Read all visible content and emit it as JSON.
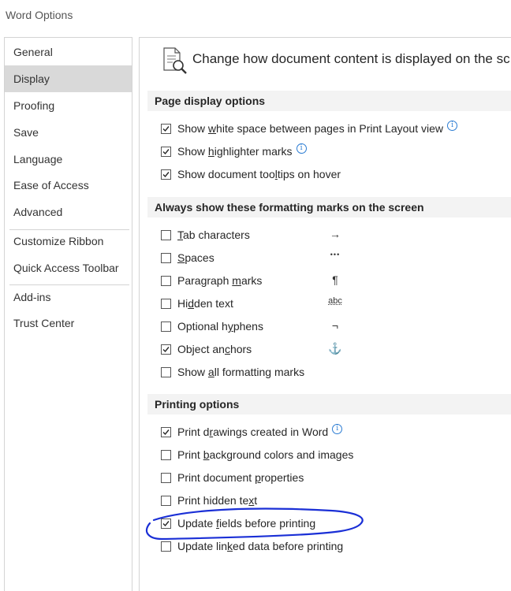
{
  "window": {
    "title": "Word Options"
  },
  "sidebar": {
    "items": [
      {
        "label": "General"
      },
      {
        "label": "Display"
      },
      {
        "label": "Proofing"
      },
      {
        "label": "Save"
      },
      {
        "label": "Language"
      },
      {
        "label": "Ease of Access"
      },
      {
        "label": "Advanced"
      },
      {
        "label": "Customize Ribbon"
      },
      {
        "label": "Quick Access Toolbar"
      },
      {
        "label": "Add-ins"
      },
      {
        "label": "Trust Center"
      }
    ],
    "selected": "Display"
  },
  "header": {
    "text": "Change how document content is displayed on the sc"
  },
  "sections": {
    "page_display": {
      "title": "Page display options",
      "options": [
        {
          "pre": "Show ",
          "u": "w",
          "post": "hite space between pages in Print Layout view",
          "checked": true
        },
        {
          "pre": "Show ",
          "u": "h",
          "post": "ighlighter marks",
          "checked": true
        },
        {
          "pre": "Show document too",
          "u": "l",
          "post": "tips on hover",
          "checked": true
        }
      ]
    },
    "formatting_marks": {
      "title": "Always show these formatting marks on the screen",
      "options": [
        {
          "pre": "",
          "u": "T",
          "post": "ab characters",
          "checked": false,
          "symbol": "→"
        },
        {
          "pre": "",
          "u": "S",
          "post": "paces",
          "checked": false,
          "symbol": "•••"
        },
        {
          "pre": "Paragraph ",
          "u": "m",
          "post": "arks",
          "checked": false,
          "symbol": "¶"
        },
        {
          "pre": "Hi",
          "u": "d",
          "post": "den text",
          "checked": false,
          "symbol": "abc"
        },
        {
          "pre": "Optional h",
          "u": "y",
          "post": "phens",
          "checked": false,
          "symbol": "¬"
        },
        {
          "pre": "Object an",
          "u": "c",
          "post": "hors",
          "checked": true,
          "symbol": "⚓"
        },
        {
          "pre": "Show ",
          "u": "a",
          "post": "ll formatting marks",
          "checked": false,
          "symbol": ""
        }
      ]
    },
    "printing": {
      "title": "Printing options",
      "options": [
        {
          "pre": "Print d",
          "u": "r",
          "post": "awings created in Word",
          "checked": true
        },
        {
          "pre": "Print ",
          "u": "b",
          "post": "ackground colors and images",
          "checked": false
        },
        {
          "pre": "Print document ",
          "u": "p",
          "post": "roperties",
          "checked": false
        },
        {
          "pre": "Print hidden te",
          "u": "x",
          "post": "t",
          "checked": false
        },
        {
          "pre": "Update ",
          "u": "f",
          "post": "ields before printing",
          "checked": true
        },
        {
          "pre": "Update lin",
          "u": "k",
          "post": "ed data before printing",
          "checked": false
        }
      ]
    }
  },
  "colors": {
    "annotation": "#1a2fd6",
    "info": "#2b7cd3",
    "selected_bg": "#d9d9d9",
    "section_bg": "#f3f3f3"
  }
}
